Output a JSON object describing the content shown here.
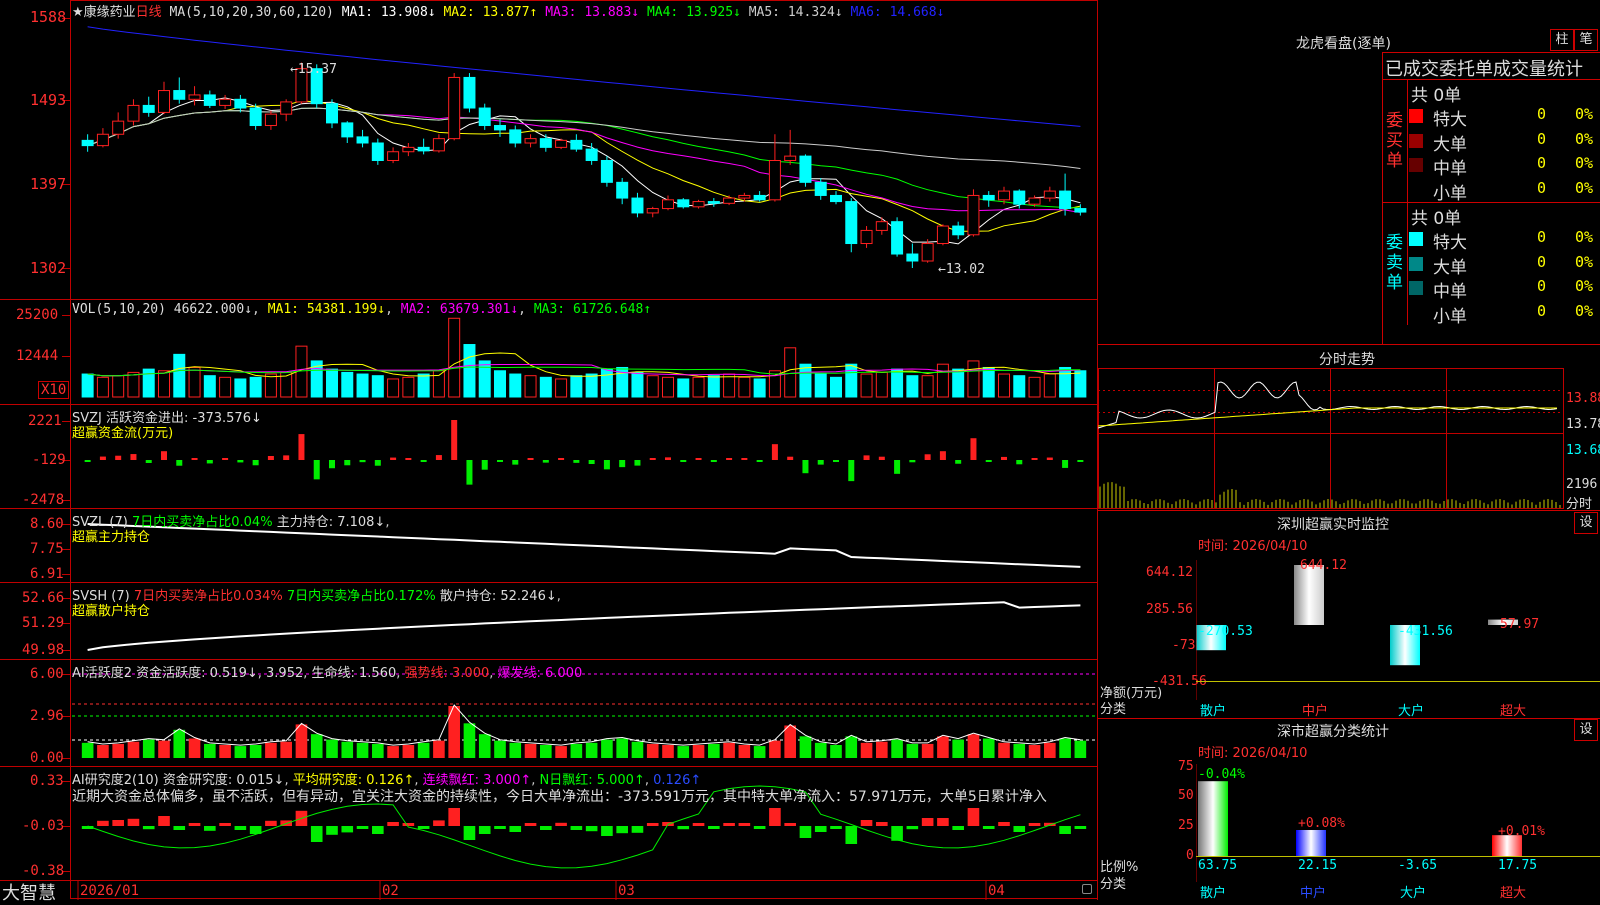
{
  "app": {
    "logo": "大智慧"
  },
  "stock": {
    "title": "★康缘药业",
    "period": "日线"
  },
  "ma": {
    "label": "MA(5,10,20,30,60,120)",
    "items": [
      {
        "text": "MA1: 13.908↓",
        "color": "#ffffff"
      },
      {
        "text": "MA2: 13.877↑",
        "color": "#ffff00"
      },
      {
        "text": "MA3: 13.883↓",
        "color": "#ff00ff"
      },
      {
        "text": "MA4: 13.925↓",
        "color": "#00ff00"
      },
      {
        "text": "MA5: 14.324↓",
        "color": "#cccccc"
      },
      {
        "text": "MA6: 14.668↓",
        "color": "#2222ff"
      }
    ]
  },
  "price_axis": [
    "1588",
    "1493",
    "1397",
    "1302"
  ],
  "price_marks": {
    "high": "←15.37",
    "low": "←13.02"
  },
  "vol": {
    "label": "VOL(5,10,20)",
    "value": "46622.000↓",
    "ma1": "MA1: 54381.199↓",
    "ma2": "MA2: 63679.301↓",
    "ma3": "MA3: 61726.648↑",
    "axis": [
      "25200",
      "12444"
    ],
    "unit": "X10"
  },
  "svzj": {
    "label": "SVZJ  活跃资金进出: -373.576↓",
    "sub": "超赢资金流(万元)",
    "axis": [
      "2221",
      "-129",
      "-2478"
    ]
  },
  "svzl": {
    "label": "SVZL (7)",
    "s1": "7日内买卖净占比0.04%",
    "s2": "主力持仓: 7.108↓",
    "sub": "超赢主力持仓",
    "axis": [
      "8.60",
      "7.75",
      "6.91"
    ]
  },
  "svsh": {
    "label": "SVSH (7)",
    "s1": "7日内买卖净占比0.034%",
    "s2": "7日内买卖净占比0.172%",
    "s3": "散户持仓: 52.246↓",
    "sub": "超赢散户持仓",
    "axis": [
      "52.66",
      "51.29",
      "49.98"
    ]
  },
  "ai": {
    "label": "AI活跃度2",
    "s1": "资金活跃度: 0.519↓",
    "s2": "3.952",
    "s3": "生命线: 1.560",
    "s4": "强势线: 3.000",
    "s5": "爆发线: 6.000",
    "axis": [
      "6.00",
      "2.96",
      "0.00"
    ]
  },
  "ai2": {
    "label": "AI研究度2(10)",
    "s1": "资金研究度: 0.015↓",
    "s2": "平均研究度: 0.126↑",
    "s3": "连续飘红: 3.000↑",
    "s4": "N日飘红: 5.000↑",
    "s5": "0.126↑",
    "note": "近期大资金总体偏多，虽不活跃，但有异动，宜关注大资金的持续性，今日大单净流出：-373.591万元，其中特大单净流入：57.971万元，大单5日累计净入",
    "axis": [
      "0.33",
      "-0.03",
      "-0.38"
    ]
  },
  "date_axis": [
    "2026/01",
    "02",
    "03",
    "04"
  ],
  "longhu": {
    "title": "龙虎看盘(逐单)",
    "btn1": "柱",
    "btn2": "笔",
    "subtitle": "已成交委托单成交量统计",
    "buy": {
      "side": "委买单",
      "total": "共 0单",
      "rows": [
        {
          "name": "特大",
          "count": "0",
          "pct": "0%",
          "color": "#ff0000"
        },
        {
          "name": "大单",
          "count": "0",
          "pct": "0%",
          "color": "#990000"
        },
        {
          "name": "中单",
          "count": "0",
          "pct": "0%",
          "color": "#660000"
        },
        {
          "name": "小单",
          "count": "0",
          "pct": "0%",
          "color": "#000000"
        }
      ]
    },
    "sell": {
      "side": "委卖单",
      "total": "共 0单",
      "rows": [
        {
          "name": "特大",
          "count": "0",
          "pct": "0%",
          "color": "#00ffff"
        },
        {
          "name": "大单",
          "count": "0",
          "pct": "0%",
          "color": "#008888"
        },
        {
          "name": "中单",
          "count": "0",
          "pct": "0%",
          "color": "#006666"
        },
        {
          "name": "小单",
          "count": "0",
          "pct": "0%",
          "color": "#000000"
        }
      ]
    }
  },
  "intraday": {
    "title": "分时走势",
    "axis": [
      "13.88",
      "13.78",
      "13.68"
    ],
    "vol_axis": [
      "2196",
      "分时"
    ]
  },
  "sz_monitor": {
    "title": "深圳超赢实时监控",
    "btn": "设",
    "time": "时间: 2026/04/10",
    "axis": [
      "644.12",
      "285.56",
      "-73",
      "-431.56"
    ],
    "ylabel": "净额(万元)",
    "xlabel": "分类",
    "categories": [
      "散户",
      "中户",
      "大户",
      "超大"
    ],
    "values": [
      -270.53,
      644.12,
      -431.56,
      57.97
    ],
    "value_labels": [
      "-270.53",
      "644.12",
      "-431.56",
      "57.97"
    ]
  },
  "sz_stats": {
    "title": "深市超赢分类统计",
    "btn": "设",
    "time": "时间: 2026/04/10",
    "axis": [
      "75",
      "50",
      "25",
      "0"
    ],
    "ylabel": "比例%",
    "xlabel": "分类",
    "categories": [
      "散户",
      "中户",
      "大户",
      "超大"
    ],
    "values": [
      63.75,
      22.15,
      -3.65,
      17.75
    ],
    "value_labels": [
      "63.75",
      "22.15",
      "-3.65",
      "17.75"
    ],
    "change_labels": [
      "-0.04%",
      "+0.08%",
      "",
      "+0.01%"
    ]
  },
  "colors": {
    "up": "#ff2020",
    "down": "#00ffff",
    "grid": "#c00000",
    "vol_up": "#ff2020",
    "vol_down": "#00ffff"
  },
  "chart_data": {
    "type": "candlestick",
    "title": "康缘药业 日线",
    "x_labels": [
      "2026/01",
      "02",
      "03",
      "04"
    ],
    "ylim": [
      13.02,
      15.88
    ],
    "ohlc": [
      [
        14.48,
        14.55,
        14.35,
        14.42
      ],
      [
        14.42,
        14.62,
        14.4,
        14.55
      ],
      [
        14.55,
        14.8,
        14.5,
        14.7
      ],
      [
        14.7,
        14.95,
        14.65,
        14.88
      ],
      [
        14.88,
        14.98,
        14.75,
        14.8
      ],
      [
        14.8,
        15.15,
        14.78,
        15.05
      ],
      [
        15.05,
        15.2,
        14.9,
        14.95
      ],
      [
        14.95,
        15.1,
        14.88,
        15.0
      ],
      [
        15.0,
        15.05,
        14.85,
        14.88
      ],
      [
        14.88,
        15.0,
        14.84,
        14.95
      ],
      [
        14.95,
        15.0,
        14.8,
        14.85
      ],
      [
        14.85,
        14.9,
        14.6,
        14.65
      ],
      [
        14.65,
        14.82,
        14.6,
        14.78
      ],
      [
        14.78,
        14.95,
        14.7,
        14.92
      ],
      [
        14.92,
        15.37,
        14.9,
        15.3
      ],
      [
        15.3,
        15.35,
        14.85,
        14.9
      ],
      [
        14.9,
        14.95,
        14.62,
        14.68
      ],
      [
        14.68,
        14.7,
        14.45,
        14.52
      ],
      [
        14.52,
        14.6,
        14.4,
        14.45
      ],
      [
        14.45,
        14.5,
        14.2,
        14.25
      ],
      [
        14.25,
        14.4,
        14.22,
        14.35
      ],
      [
        14.35,
        14.45,
        14.3,
        14.4
      ],
      [
        14.4,
        14.5,
        14.32,
        14.36
      ],
      [
        14.36,
        14.55,
        14.34,
        14.5
      ],
      [
        14.5,
        15.25,
        14.48,
        15.2
      ],
      [
        15.2,
        15.25,
        14.8,
        14.85
      ],
      [
        14.85,
        14.9,
        14.6,
        14.65
      ],
      [
        14.65,
        14.72,
        14.52,
        14.6
      ],
      [
        14.6,
        14.65,
        14.4,
        14.45
      ],
      [
        14.45,
        14.55,
        14.4,
        14.5
      ],
      [
        14.5,
        14.55,
        14.35,
        14.4
      ],
      [
        14.4,
        14.5,
        14.38,
        14.48
      ],
      [
        14.48,
        14.55,
        14.35,
        14.38
      ],
      [
        14.38,
        14.45,
        14.2,
        14.25
      ],
      [
        14.25,
        14.3,
        13.95,
        14.0
      ],
      [
        14.0,
        14.05,
        13.75,
        13.82
      ],
      [
        13.82,
        13.88,
        13.6,
        13.65
      ],
      [
        13.65,
        13.72,
        13.6,
        13.7
      ],
      [
        13.7,
        13.85,
        13.68,
        13.8
      ],
      [
        13.8,
        13.82,
        13.7,
        13.72
      ],
      [
        13.72,
        13.8,
        13.7,
        13.78
      ],
      [
        13.78,
        13.82,
        13.72,
        13.76
      ],
      [
        13.76,
        13.85,
        13.74,
        13.82
      ],
      [
        13.82,
        13.88,
        13.78,
        13.85
      ],
      [
        13.85,
        13.9,
        13.78,
        13.8
      ],
      [
        13.8,
        14.55,
        13.78,
        14.25
      ],
      [
        14.25,
        14.6,
        14.2,
        14.3
      ],
      [
        14.3,
        14.32,
        13.95,
        14.0
      ],
      [
        14.0,
        14.05,
        13.8,
        13.85
      ],
      [
        13.85,
        13.9,
        13.75,
        13.78
      ],
      [
        13.78,
        13.82,
        13.2,
        13.3
      ],
      [
        13.3,
        13.5,
        13.25,
        13.45
      ],
      [
        13.45,
        13.6,
        13.4,
        13.55
      ],
      [
        13.55,
        13.6,
        13.15,
        13.18
      ],
      [
        13.18,
        13.3,
        13.02,
        13.1
      ],
      [
        13.1,
        13.35,
        13.08,
        13.3
      ],
      [
        13.3,
        13.52,
        13.28,
        13.5
      ],
      [
        13.5,
        13.55,
        13.35,
        13.4
      ],
      [
        13.4,
        13.92,
        13.38,
        13.85
      ],
      [
        13.85,
        13.9,
        13.72,
        13.8
      ],
      [
        13.8,
        13.95,
        13.75,
        13.9
      ],
      [
        13.9,
        13.92,
        13.7,
        13.75
      ],
      [
        13.75,
        13.85,
        13.72,
        13.82
      ],
      [
        13.82,
        13.95,
        13.78,
        13.9
      ],
      [
        13.9,
        14.1,
        13.62,
        13.7
      ],
      [
        13.7,
        13.75,
        13.62,
        13.66
      ]
    ],
    "volume": [
      14,
      12,
      13,
      15,
      17,
      16,
      26,
      18,
      13,
      12,
      11,
      12,
      14,
      15,
      31,
      22,
      17,
      15,
      14,
      13,
      11,
      12,
      14,
      16,
      48,
      32,
      22,
      16,
      14,
      13,
      12,
      11,
      13,
      14,
      17,
      18,
      15,
      13,
      12,
      11,
      12,
      13,
      14,
      12,
      11,
      16,
      30,
      20,
      14,
      12,
      20,
      14,
      15,
      17,
      13,
      13,
      20,
      17,
      22,
      18,
      14,
      13,
      12,
      14,
      18,
      16
    ]
  }
}
